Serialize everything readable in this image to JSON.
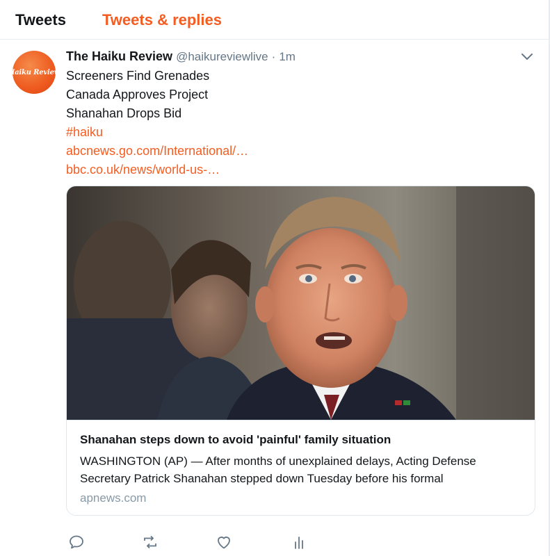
{
  "tabs": [
    {
      "label": "Tweets",
      "active": false
    },
    {
      "label": "Tweets & replies",
      "active": true
    }
  ],
  "colors": {
    "accent": "#f45d22",
    "muted": "#657786",
    "border": "#e1e8ed"
  },
  "tweet": {
    "avatar_text": "Haiku Review",
    "author_name": "The Haiku Review",
    "handle": "@haikureviewlive",
    "separator": "·",
    "time": "1m",
    "lines": [
      "Screeners Find Grenades",
      "Canada Approves Project",
      "Shanahan Drops Bid"
    ],
    "hashtag": "#haiku",
    "links": [
      "abcnews.go.com/International/…",
      "bbc.co.uk/news/world-us-…"
    ],
    "card": {
      "title": "Shanahan steps down to avoid 'painful' family situation",
      "description": "WASHINGTON (AP) — After months of unexplained delays, Acting Defense Secretary Patrick Shanahan stepped down Tuesday before his formal",
      "domain": "apnews.com"
    },
    "actions": [
      "reply-icon",
      "retweet-icon",
      "like-icon",
      "analytics-icon"
    ]
  }
}
